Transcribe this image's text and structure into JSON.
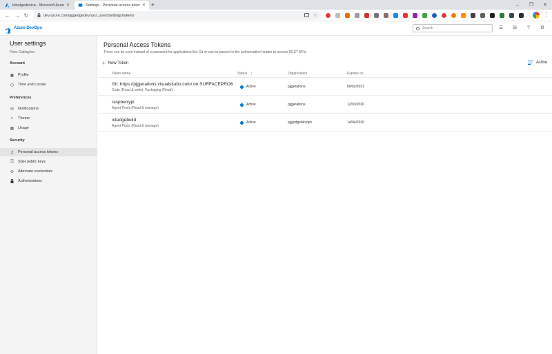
{
  "browser": {
    "tabs": [
      {
        "title": "lotedgedevice - Microsoft Azure",
        "favicon": "azure-icon"
      },
      {
        "title": "Settings - Personal access tokens",
        "favicon": "devops-icon"
      }
    ],
    "new_tab": "+",
    "window_controls": {
      "minimize": "–",
      "restore": "❐",
      "close": "✕"
    },
    "url": "dev.azure.com/pjgjedgedevops/_usersSettings/tokens"
  },
  "app": {
    "brand": "Azure DevOps",
    "search_placeholder": "Search",
    "accent": "#0078d4"
  },
  "sidebar": {
    "title": "User settings",
    "user": "Pete Gallagher",
    "sections": [
      {
        "label": "Account",
        "items": [
          {
            "label": "Profile",
            "icon": "profile-icon"
          },
          {
            "label": "Time and Locale",
            "icon": "clock-icon"
          }
        ]
      },
      {
        "label": "Preferences",
        "items": [
          {
            "label": "Notifications",
            "icon": "notifications-icon"
          },
          {
            "label": "Theme",
            "icon": "theme-icon"
          },
          {
            "label": "Usage",
            "icon": "usage-icon"
          }
        ]
      },
      {
        "label": "Security",
        "items": [
          {
            "label": "Personal access tokens",
            "icon": "key-icon",
            "selected": true
          },
          {
            "label": "SSH public keys",
            "icon": "ssh-key-icon"
          },
          {
            "label": "Alternate credentials",
            "icon": "credentials-icon"
          },
          {
            "label": "Authorizations",
            "icon": "lock-icon"
          }
        ]
      }
    ]
  },
  "main": {
    "title": "Personal Access Tokens",
    "description": "These can be used instead of a password for applications like Git or can be passed in the authorization header to access REST APIs",
    "new_token_label": "New Token",
    "filter_label": "Active",
    "columns": {
      "name": "Token name",
      "status": "Status",
      "status_sort": "↓",
      "organization": "Organization",
      "expires": "Expires on"
    },
    "tokens": [
      {
        "name": "Git: https://pjgjerations.visualstudio.com/ on SURFACEPRO6",
        "scope": "Code (Read & write); Packaging (Read)",
        "status": "Active",
        "organization": "pjgjerations",
        "expires": "09/02/2021"
      },
      {
        "name": "raspberrypi",
        "scope": "Agent Pools (Read & manage)",
        "status": "Active",
        "organization": "pjgjerations",
        "expires": "12/03/2020"
      },
      {
        "name": "iotedgebuild",
        "scope": "Agent Pools (Read & manage)",
        "status": "Active",
        "organization": "pjgjedgedevops",
        "expires": "14/04/2020"
      }
    ]
  }
}
